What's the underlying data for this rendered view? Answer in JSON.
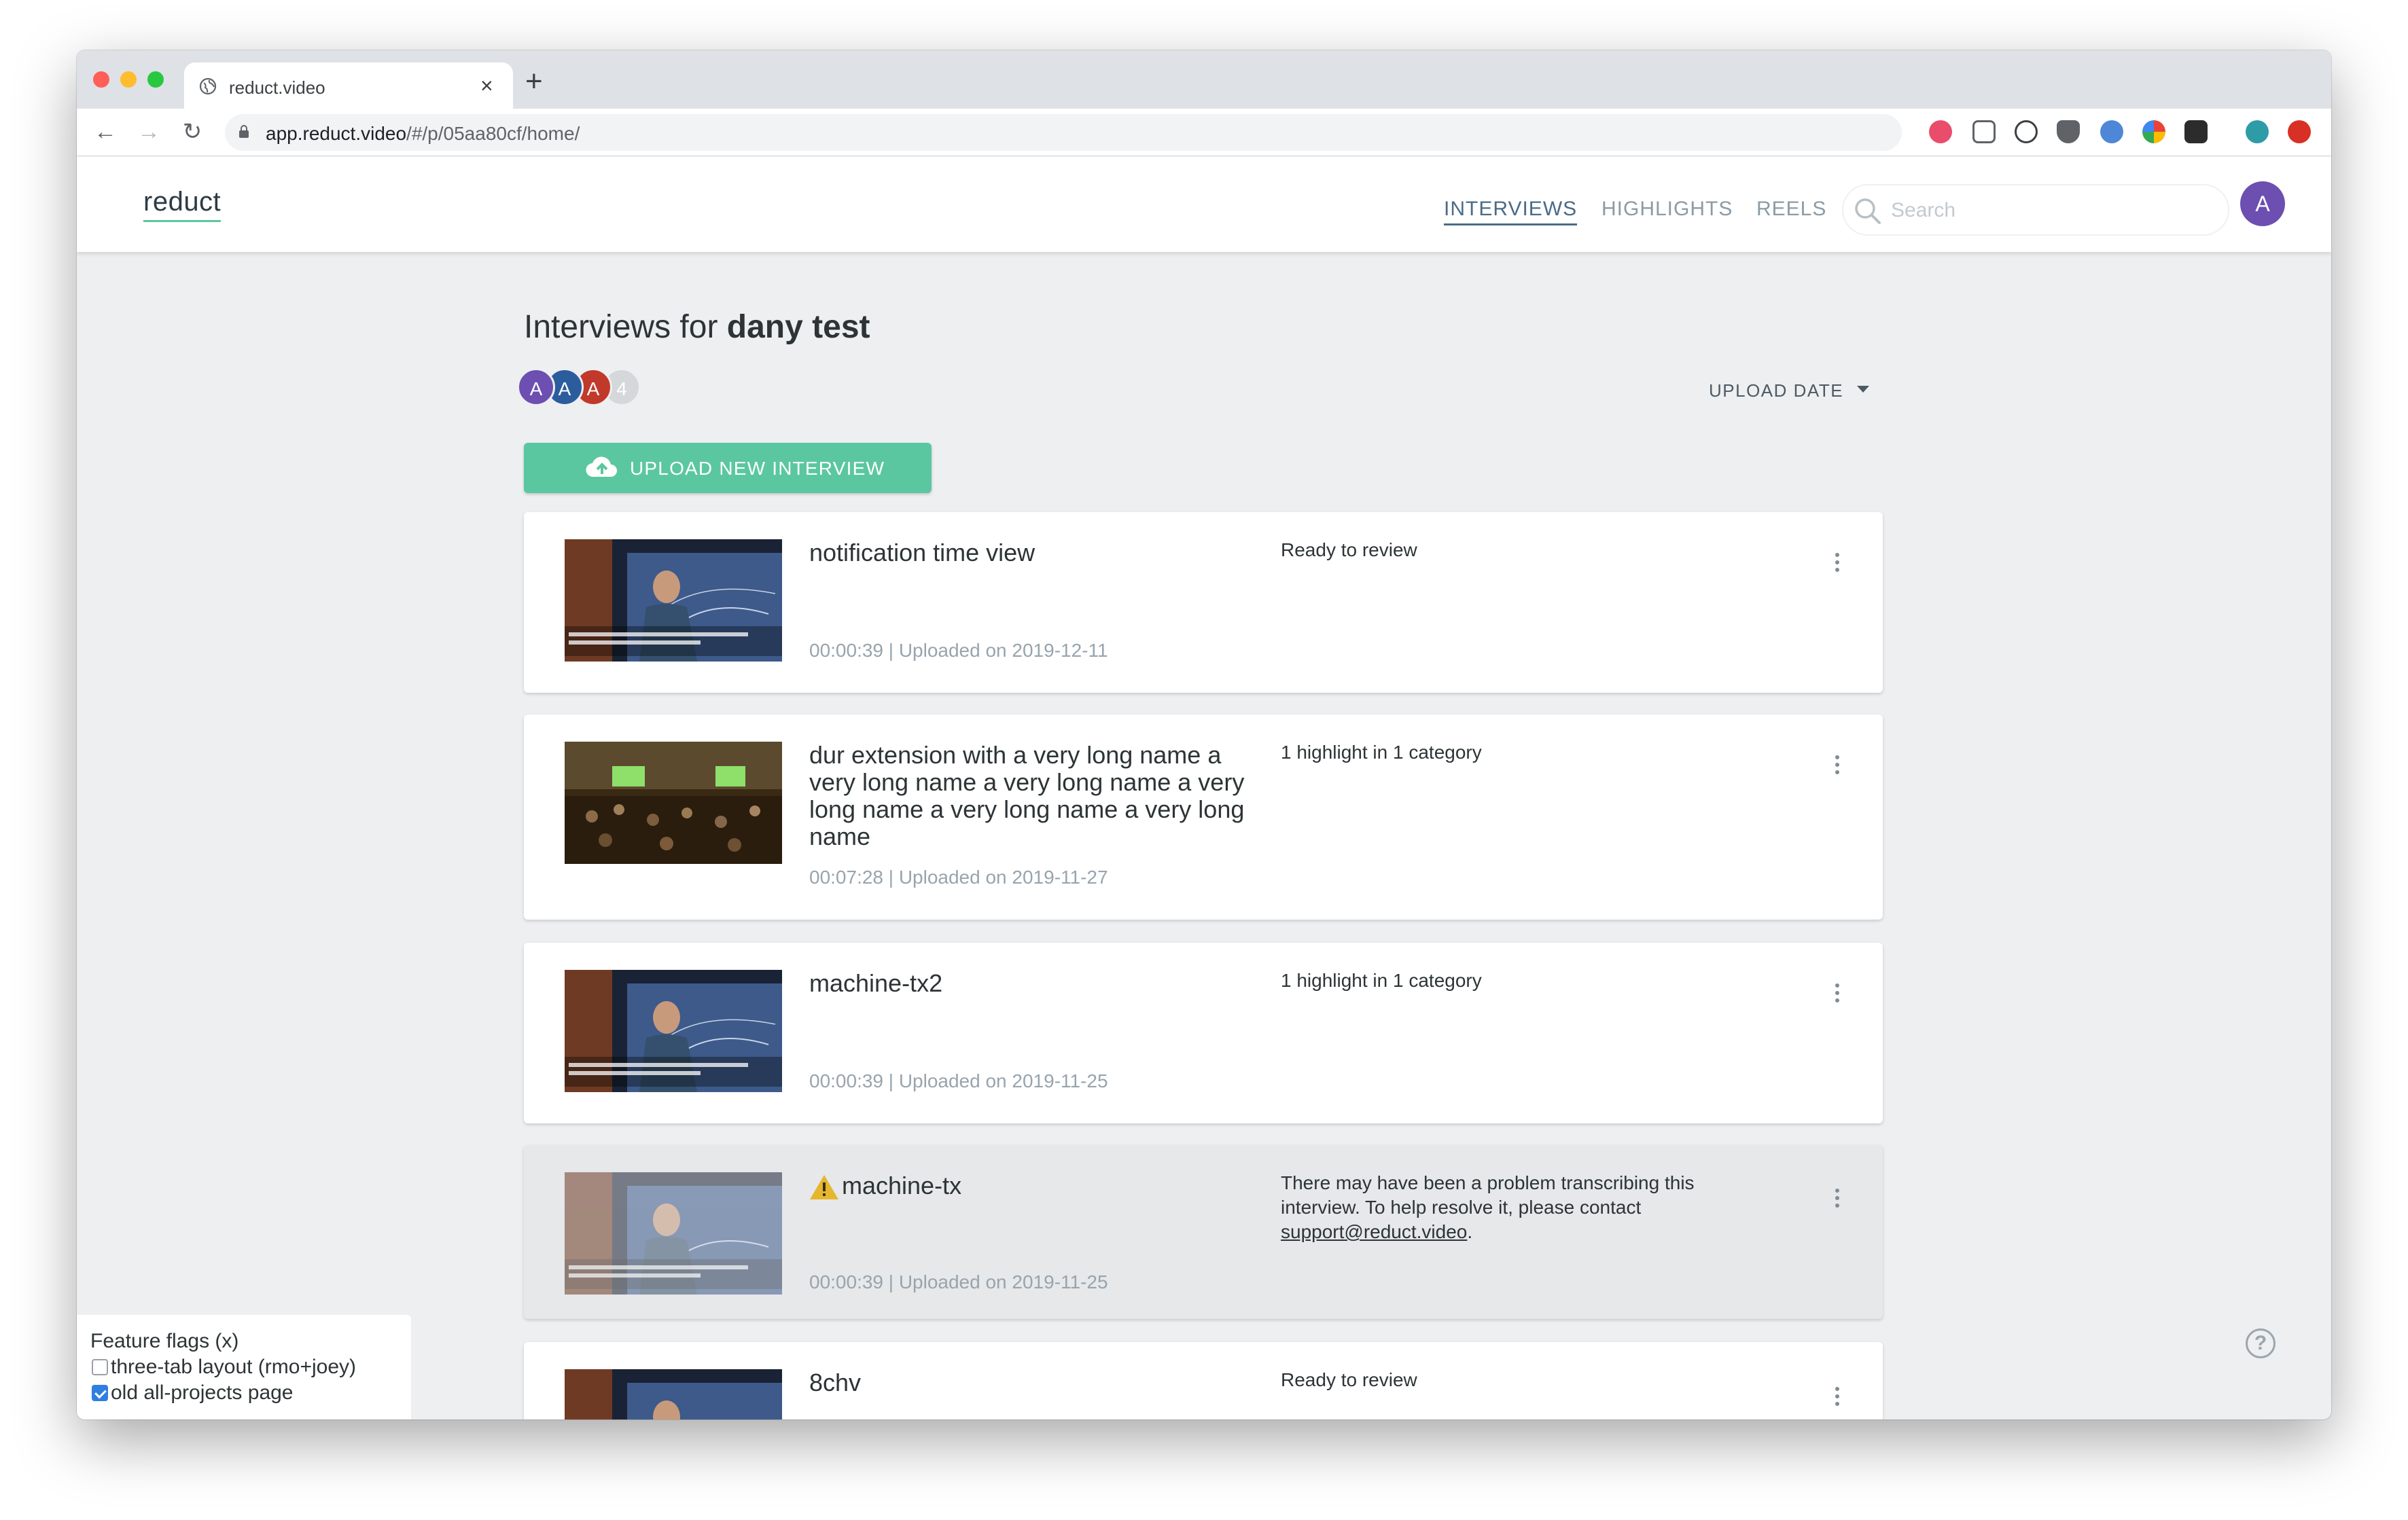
{
  "browser": {
    "tab_title": "reduct.video",
    "url_host": "app.reduct.video",
    "url_path": "/#/p/05aa80cf/home/",
    "new_tab_symbol": "+",
    "close_symbol": "×"
  },
  "header": {
    "logo": "reduct",
    "nav": [
      "INTERVIEWS",
      "HIGHLIGHTS",
      "REELS"
    ],
    "active_nav": "INTERVIEWS",
    "search_placeholder": "Search",
    "user_initial": "A",
    "accent_color": "#5bc7a0"
  },
  "main": {
    "heading_prefix": "Interviews for",
    "project_name": "dany test",
    "collaborators": [
      {
        "initial": "A",
        "color": "#6c4fb0"
      },
      {
        "initial": "A",
        "color": "#2b5c9e"
      },
      {
        "initial": "A",
        "color": "#c0392b"
      },
      {
        "initial": "4",
        "color": "#d4d8db"
      }
    ],
    "sort_label": "UPLOAD DATE",
    "upload_button": "UPLOAD NEW INTERVIEW",
    "interviews": [
      {
        "title": "notification time view",
        "meta": "00:00:39 | Uploaded on 2019-12-11",
        "status": "Ready to review",
        "thumb": "lecture-thumbnail"
      },
      {
        "title": "dur extension with a very long name a very long name a very long name a very long name a very long name a very long name",
        "meta": "00:07:28 | Uploaded on 2019-11-27",
        "status": "1 highlight in 1 category",
        "thumb": "conference-thumbnail"
      },
      {
        "title": "machine-tx2",
        "meta": "00:00:39 | Uploaded on 2019-11-25",
        "status": "1 highlight in 1 category",
        "thumb": "lecture-thumbnail"
      },
      {
        "title": "machine-tx",
        "meta": "00:00:39 | Uploaded on 2019-11-25",
        "status_prefix": "There may have been a problem transcribing this interview. To help resolve it, please contact ",
        "status_link": "support@reduct.video",
        "status_suffix": ".",
        "thumb": "lecture-thumbnail",
        "warning": true
      },
      {
        "title": "8chv",
        "status": "Ready to review",
        "thumb": "lecture-thumbnail"
      }
    ]
  },
  "feature_flags": {
    "title": "Feature flags (x)",
    "flags": [
      {
        "label": "three-tab layout (rmo+joey)",
        "checked": false
      },
      {
        "label": "old all-projects page",
        "checked": true
      }
    ]
  },
  "help": "?"
}
